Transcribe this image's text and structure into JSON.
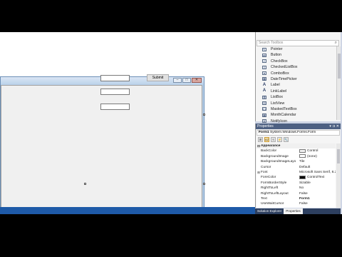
{
  "form": {
    "submit_label": "Submit",
    "window_buttons": [
      "–",
      "□",
      "✕"
    ]
  },
  "toolbox": {
    "search_placeholder": "Search Toolbox",
    "items": [
      {
        "label": "Pointer",
        "icon": "pointer-icon",
        "glyph": "↖"
      },
      {
        "label": "Button",
        "icon": "button-icon",
        "glyph": "ab"
      },
      {
        "label": "CheckBox",
        "icon": "checkbox-icon",
        "glyph": "✓"
      },
      {
        "label": "CheckedListBox",
        "icon": "checkedlistbox-icon",
        "glyph": "≡"
      },
      {
        "label": "ComboBox",
        "icon": "combobox-icon",
        "glyph": "▾"
      },
      {
        "label": "DateTimePicker",
        "icon": "datetimepicker-icon",
        "glyph": "▦"
      },
      {
        "label": "Label",
        "icon": "label-icon",
        "glyph": "A"
      },
      {
        "label": "LinkLabel",
        "icon": "linklabel-icon",
        "glyph": "A"
      },
      {
        "label": "ListBox",
        "icon": "listbox-icon",
        "glyph": "≣"
      },
      {
        "label": "ListView",
        "icon": "listview-icon",
        "glyph": "☷"
      },
      {
        "label": "MaskedTextBox",
        "icon": "maskedtextbox-icon",
        "glyph": "(.)"
      },
      {
        "label": "MonthCalendar",
        "icon": "monthcalendar-icon",
        "glyph": "▦"
      },
      {
        "label": "NotifyIcon",
        "icon": "notifyicon-icon",
        "glyph": "◘"
      }
    ]
  },
  "properties": {
    "title": "Properties",
    "title_controls": "▾ ⊐ ✕",
    "object_name": "Form1",
    "object_type": "System.Windows.Forms.Form",
    "toolbar_buttons": [
      "⊞",
      "AZ",
      "ϟ",
      "⚡",
      "🔧"
    ],
    "rows": [
      {
        "type": "category",
        "expander": "⊟",
        "name": "Appearance",
        "value": ""
      },
      {
        "name": "BackColor",
        "value": "Control",
        "swatch": "#f0f0f0"
      },
      {
        "name": "BackgroundImage",
        "value": "(none)",
        "swatch": "#ffffff"
      },
      {
        "name": "BackgroundImageLayo",
        "value": "Tile"
      },
      {
        "name": "Cursor",
        "value": "Default"
      },
      {
        "expander": "⊞",
        "name": "Font",
        "value": "Microsoft Sans Serif, 8.25"
      },
      {
        "name": "ForeColor",
        "value": "ControlText",
        "swatch": "#000000"
      },
      {
        "name": "FormBorderStyle",
        "value": "Sizable"
      },
      {
        "name": "RightToLeft",
        "value": "No"
      },
      {
        "name": "RightToLeftLayout",
        "value": "False"
      },
      {
        "name": "Text",
        "value": "Form1",
        "bold": true
      },
      {
        "name": "UseWaitCursor",
        "value": "False"
      }
    ]
  },
  "tabs": [
    "Solution Explorer",
    "Properties"
  ],
  "colors": {
    "accent": "#1e5aa8",
    "panel_title": "#4d6082",
    "form_chrome": "#b9d1ea"
  }
}
